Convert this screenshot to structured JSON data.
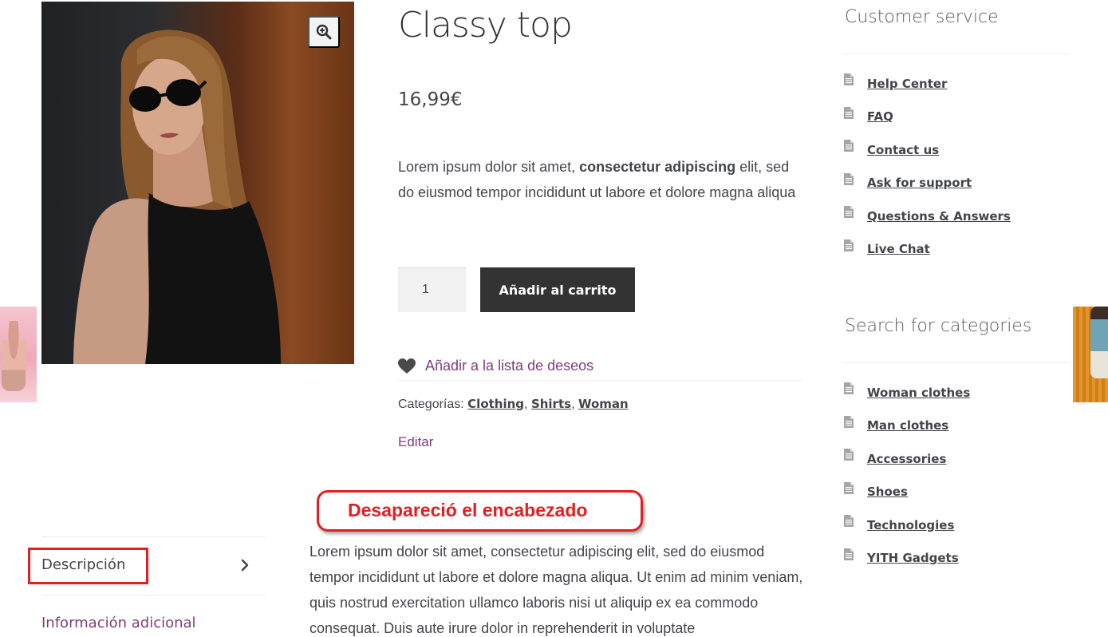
{
  "product": {
    "title": "Classy top",
    "price": "16,99€",
    "short_description": {
      "before": "Lorem ipsum dolor sit amet, ",
      "bold": "consectetur adipiscing",
      "after": " elit, sed do eiusmod tempor incididunt ut labore et dolore magna aliqua"
    },
    "quantity": "1",
    "add_to_cart_label": "Añadir al carrito",
    "wishlist_label": "Añadir a la lista de deseos",
    "categories_label": "Categorías:",
    "categories": [
      "Clothing",
      "Shirts",
      "Woman"
    ],
    "edit_label": "Editar"
  },
  "tabs": {
    "description": "Descripción",
    "additional_info": "Información adicional"
  },
  "long_description": "Lorem ipsum dolor sit amet, consectetur adipiscing elit, sed do eiusmod tempor incididunt ut labore et dolore magna aliqua. Ut enim ad minim veniam, quis nostrud exercitation ullamco laboris nisi ut aliquip ex ea commodo consequat. Duis aute irure dolor in reprehenderit in voluptate",
  "annotation": {
    "text": "Desapareció el encabezado"
  },
  "sidebar": {
    "customer_service": {
      "title": "Customer service",
      "items": [
        "Help Center",
        "FAQ",
        "Contact us",
        "Ask for support",
        "Questions & Answers",
        "Live Chat"
      ]
    },
    "categories": {
      "title": "Search for categories",
      "items": [
        "Woman clothes",
        "Man clothes",
        "Accessories",
        "Shoes",
        "Technologies",
        "YITH Gadgets"
      ]
    }
  },
  "icons": {
    "zoom": "zoom-in-icon",
    "wishlist": "heart-icon",
    "tab_arrow": "chevron-right-icon",
    "list_item": "document-icon"
  },
  "colors": {
    "accent_link": "#7d3e7a",
    "button_dark": "#333333",
    "annotation_red": "#e02020"
  }
}
